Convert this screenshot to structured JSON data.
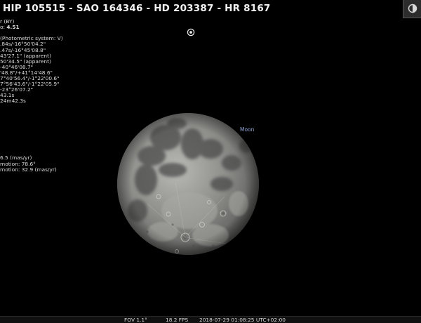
{
  "header": {
    "title": "HIP 105515 - SAO 164346 - HD 203387 - HR 8167"
  },
  "info_panel": {
    "lines": [
      "r (BY)",
      "o: 4.51",
      "",
      "(Photometric system: V)",
      ".84s/-16°50'04.2\"",
      ".47s/-16°45'08.8\"",
      "43'27.1\" (apparent)",
      "50'34.5\" (apparent)",
      "-40°46'08.7\"",
      "'48.8\"/+41°14'48.6\"",
      "7°40'56.4\"/-1°22'00.6\"",
      "7°56'43.6\"/-1°22'05.9\"",
      "-23°26'07.2\"",
      "43.1s",
      "24m42.3s",
      "",
      "",
      "",
      "",
      "",
      "",
      "",
      "",
      "",
      "6.5 (mas/yr)",
      "motion: 78.6°",
      "motion: 32.9 (mas/yr)"
    ],
    "magnitude_value": "4.51"
  },
  "sky": {
    "moon_label": "Moon",
    "label_color": "#8fa5d6",
    "selection_marker": "target-reticle-icon"
  },
  "statusbar": {
    "fov": "FOV 1.1°",
    "fps": "18.2 FPS",
    "datetime": "2018-07-29 01:08:25 UTC+02:00"
  },
  "toolbar": {
    "corner_icon": "window-toggle-icon"
  }
}
